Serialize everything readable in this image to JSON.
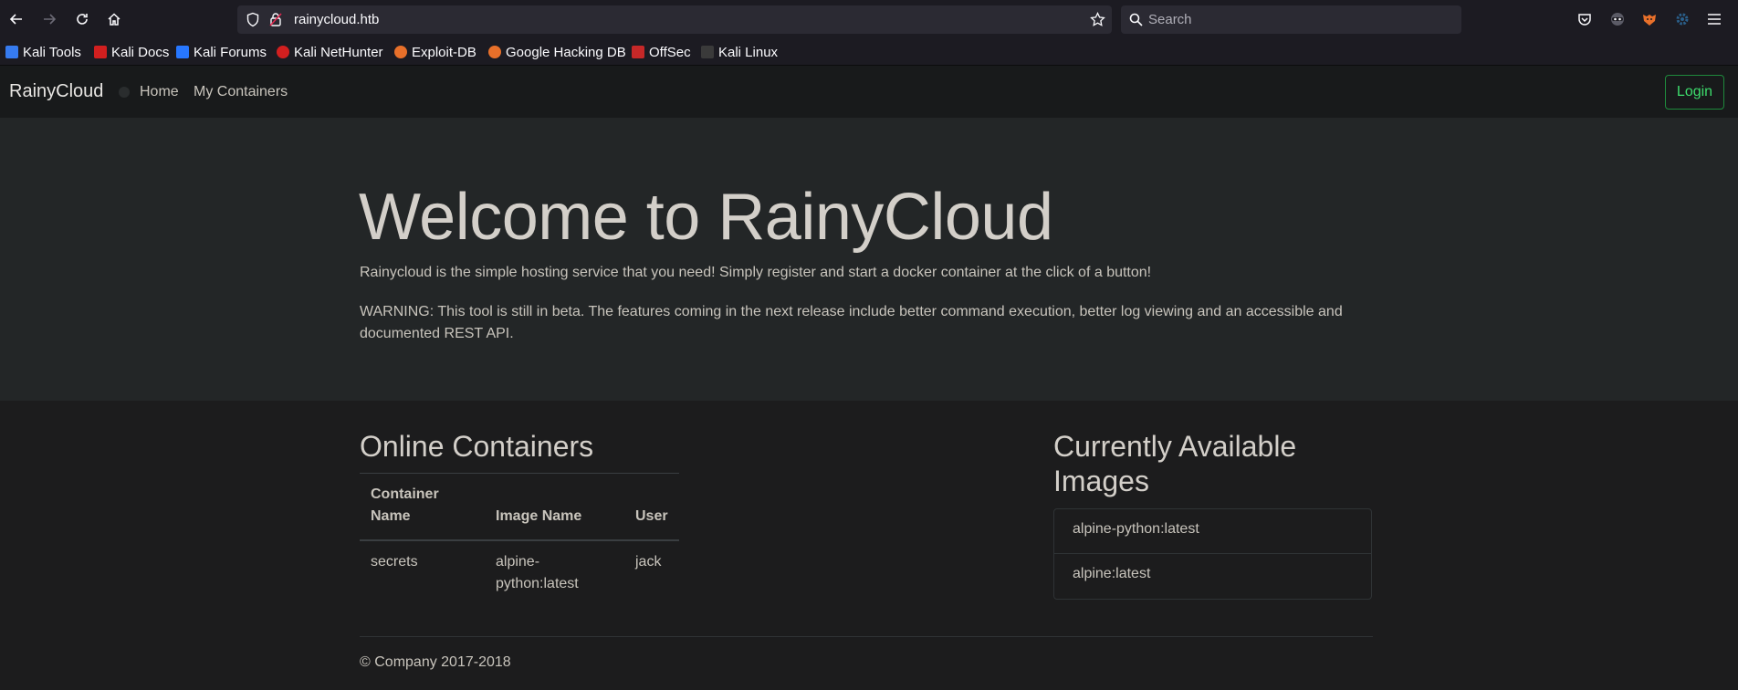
{
  "browser": {
    "url": "rainycloud.htb",
    "search_placeholder": "Search",
    "bookmarks": [
      {
        "label": "Kali Tools",
        "color": "#367bf0"
      },
      {
        "label": "Kali Docs",
        "color": "#d21f1f"
      },
      {
        "label": "Kali Forums",
        "color": "#2777ff"
      },
      {
        "label": "Kali NetHunter",
        "color": "#d21f1f"
      },
      {
        "label": "Exploit-DB",
        "color": "#e8702a"
      },
      {
        "label": "Google Hacking DB",
        "color": "#e8702a"
      },
      {
        "label": "OffSec",
        "color": "#c62828"
      },
      {
        "label": "Kali Linux",
        "color": "#3a3a3a"
      }
    ]
  },
  "site_nav": {
    "brand": "RainyCloud",
    "links": [
      "Home",
      "My Containers"
    ],
    "login": "Login",
    "login_color": "#3ddc6c"
  },
  "jumbotron": {
    "title": "Welcome to RainyCloud",
    "lead": "Rainycloud is the simple hosting service that you need! Simply register and start a docker container at the click of a button!",
    "warning": "WARNING: This tool is still in beta. The features coming in the next release include better command execution, better log viewing and an accessible and documented REST API."
  },
  "online_containers": {
    "title": "Online Containers",
    "headers": [
      "Container Name",
      "Image Name",
      "User"
    ],
    "rows": [
      {
        "container": "secrets",
        "image": "alpine-python:latest",
        "user": "jack"
      }
    ]
  },
  "images": {
    "title": "Currently Available Images",
    "items": [
      "alpine-python:latest",
      "alpine:latest"
    ]
  },
  "footer": "© Company 2017-2018"
}
